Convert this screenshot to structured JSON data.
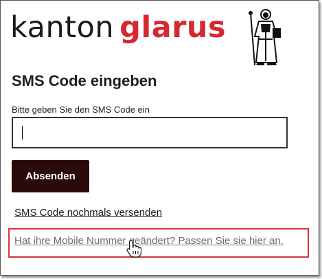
{
  "header": {
    "logo_word1": "kanton",
    "logo_word2": "glarus",
    "logo_color_primary": "#1a1a1a",
    "logo_color_accent": "#d7282f",
    "emblem_icon": "saint-fridolin-emblem-icon"
  },
  "form": {
    "title": "SMS Code eingeben",
    "field_label": "Bitte geben Sie den SMS Code ein",
    "input_value": "",
    "submit_label": "Absenden",
    "submit_color": "#2b0a0c"
  },
  "links": {
    "resend": "SMS Code nochmals versenden",
    "change_number": "Hat ihre Mobile Nummer geändert? Passen Sie sie hier an."
  },
  "annotation": {
    "highlight_color": "#d9343a",
    "cursor_icon": "hand-pointer-icon"
  }
}
